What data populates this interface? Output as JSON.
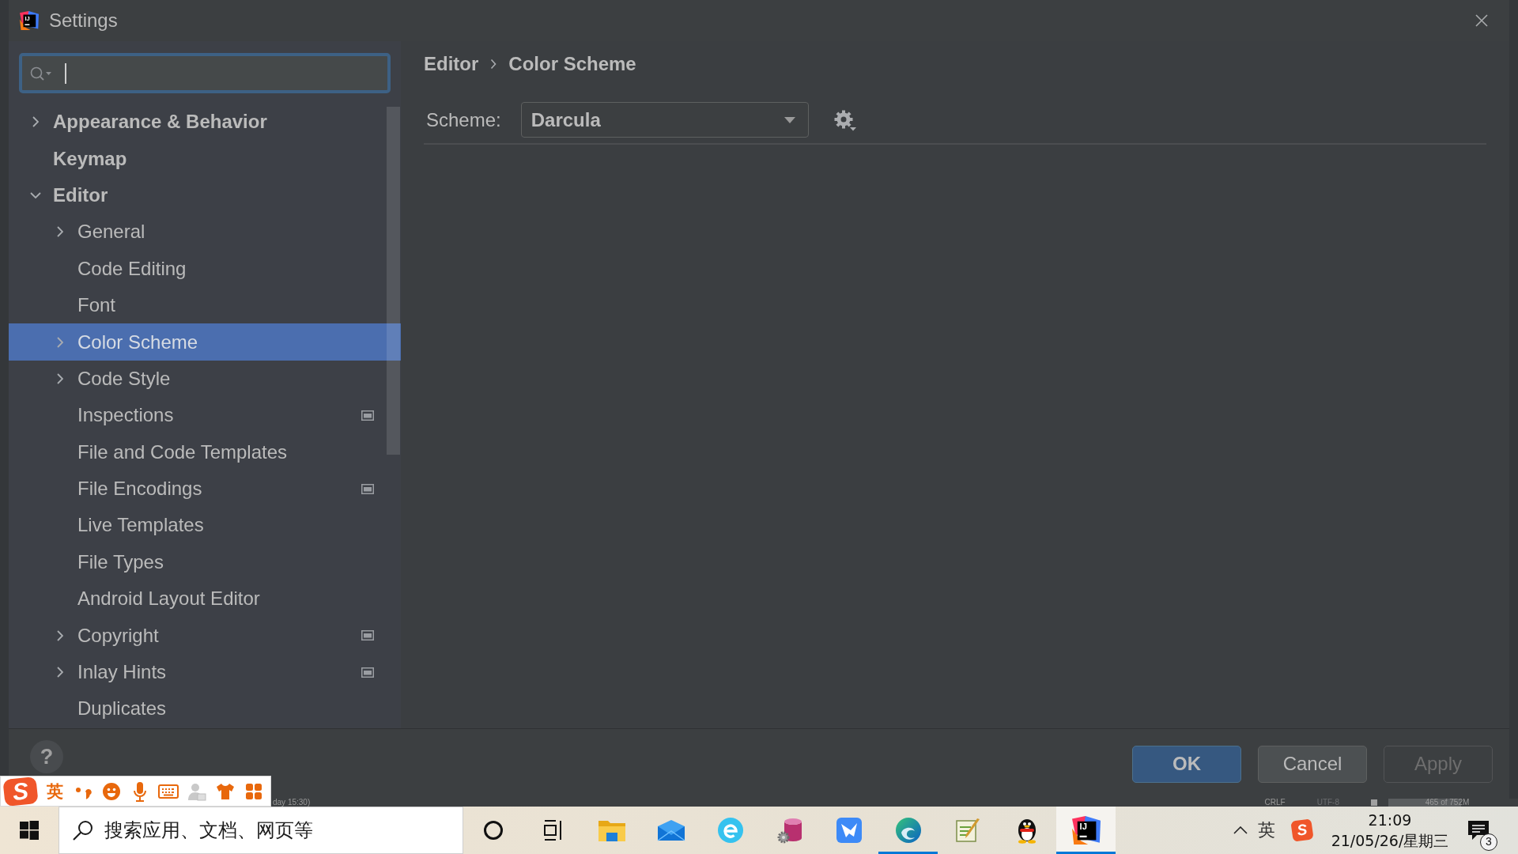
{
  "window": {
    "title": "Settings",
    "icon_text": "IJ"
  },
  "sidebar": {
    "search": {
      "focused": true
    },
    "tree": [
      {
        "label": "Appearance & Behavior",
        "expanded": false,
        "selected": false,
        "project_level": false
      },
      {
        "label": "Keymap",
        "selected": false,
        "project_level": false
      },
      {
        "label": "Editor",
        "expanded": true,
        "selected": false,
        "project_level": false,
        "children": [
          {
            "label": "General",
            "expanded": false,
            "selected": false,
            "project_level": false
          },
          {
            "label": "Code Editing",
            "selected": false,
            "project_level": false
          },
          {
            "label": "Font",
            "selected": false,
            "project_level": false
          },
          {
            "label": "Color Scheme",
            "expanded": false,
            "selected": true,
            "project_level": false
          },
          {
            "label": "Code Style",
            "expanded": false,
            "selected": false,
            "project_level": false
          },
          {
            "label": "Inspections",
            "selected": false,
            "project_level": true
          },
          {
            "label": "File and Code Templates",
            "selected": false,
            "project_level": false
          },
          {
            "label": "File Encodings",
            "selected": false,
            "project_level": true
          },
          {
            "label": "Live Templates",
            "selected": false,
            "project_level": false
          },
          {
            "label": "File Types",
            "selected": false,
            "project_level": false
          },
          {
            "label": "Android Layout Editor",
            "selected": false,
            "project_level": false
          },
          {
            "label": "Copyright",
            "expanded": false,
            "selected": false,
            "project_level": true
          },
          {
            "label": "Inlay Hints",
            "expanded": false,
            "selected": false,
            "project_level": true
          },
          {
            "label": "Duplicates",
            "selected": false,
            "project_level": false
          }
        ]
      }
    ]
  },
  "content": {
    "breadcrumb": [
      "Editor",
      "Color Scheme"
    ],
    "scheme": {
      "label": "Scheme:",
      "value": "Darcula"
    }
  },
  "footer": {
    "help": "?",
    "buttons": [
      {
        "label": "OK",
        "default": true,
        "disabled": false
      },
      {
        "label": "Cancel",
        "default": false,
        "disabled": false
      },
      {
        "label": "Apply",
        "default": false,
        "disabled": true
      }
    ]
  },
  "background_status_bar": {
    "items": [
      {
        "text": "day 15:30)",
        "dimmed": false
      },
      {
        "text": "CRLF",
        "dimmed": false
      },
      {
        "text": "UTF-8",
        "dimmed": true
      }
    ],
    "memory": {
      "text": "465 of 752M",
      "level": 0.62
    }
  },
  "ime_toolbar": {
    "logo_text": "S",
    "mode": "英"
  },
  "taskbar": {
    "search": {
      "placeholder": "搜索应用、文档、网页等"
    },
    "buttons": [
      {
        "running": false,
        "active": false
      },
      {
        "running": false,
        "active": false
      },
      {
        "running": false,
        "active": false
      },
      {
        "running": false,
        "active": false
      },
      {
        "running": false,
        "active": false
      },
      {
        "running": false,
        "active": false
      },
      {
        "running": false,
        "active": false
      },
      {
        "running": true,
        "active": false
      },
      {
        "running": false,
        "active": false
      },
      {
        "running": false,
        "active": false
      },
      {
        "running": true,
        "active": true,
        "logo_text": "IJ"
      }
    ],
    "tray": {
      "ime": "英",
      "logo_text": "S",
      "time": "21:09",
      "date": "21/05/26/星期三",
      "notifications": "3"
    }
  }
}
